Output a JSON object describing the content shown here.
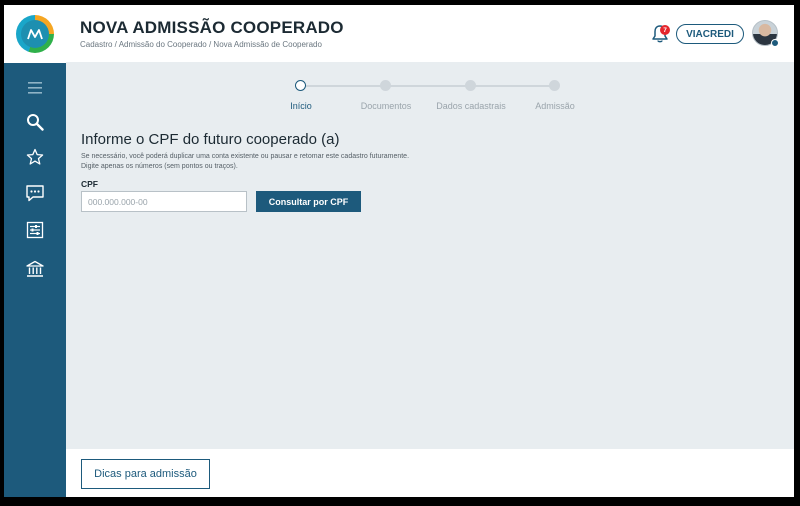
{
  "header": {
    "title": "NOVA ADMISSÃO COOPERADO",
    "breadcrumb": "Cadastro / Admissão do Cooperado / Nova Admissão de Cooperado",
    "notification_count": "7",
    "cooperative_label": "VIACREDI"
  },
  "sidebar": {
    "items": [
      {
        "icon": "menu-icon"
      },
      {
        "icon": "search-icon"
      },
      {
        "icon": "star-icon"
      },
      {
        "icon": "chat-icon"
      },
      {
        "icon": "sliders-icon"
      },
      {
        "icon": "bank-icon"
      }
    ]
  },
  "stepper": {
    "steps": [
      {
        "label": "Início",
        "active": true
      },
      {
        "label": "Documentos",
        "active": false
      },
      {
        "label": "Dados cadastrais",
        "active": false
      },
      {
        "label": "Admissão",
        "active": false
      }
    ]
  },
  "form": {
    "title": "Informe o CPF do futuro cooperado (a)",
    "hint_line1": "Se necessário, você poderá duplicar uma conta existente ou pausar e retomar este cadastro futuramente.",
    "hint_line2": "Digite apenas os números (sem pontos ou traços).",
    "cpf_label": "CPF",
    "cpf_value": "",
    "cpf_placeholder": "000.000.000-00",
    "consult_button": "Consultar por CPF"
  },
  "footer": {
    "tips_button": "Dicas para admissão"
  },
  "colors": {
    "primary": "#1d5a7c",
    "background": "#e8edf0",
    "badge": "#e5262c"
  }
}
